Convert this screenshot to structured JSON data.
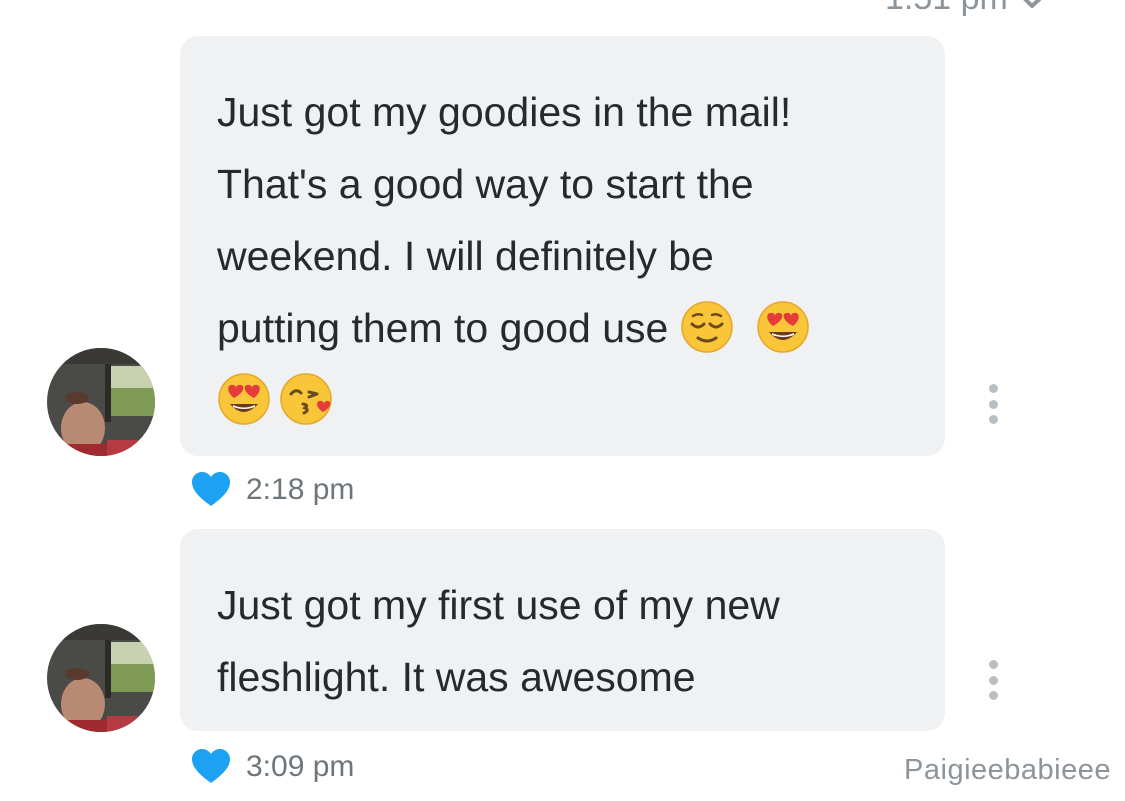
{
  "previous_message": {
    "time": "1:51 pm",
    "read_icon": "double-check-icon"
  },
  "messages": [
    {
      "text": "Just got my goodies in the mail!\nThat's a good way to start the\nweekend. I will definitely be\nputting them to good use",
      "emojis_inline": [
        "relieved-face-emoji",
        "heart-eyes-emoji"
      ],
      "emojis_next_line": [
        "heart-eyes-emoji",
        "kissing-heart-emoji"
      ],
      "time": "2:18 pm",
      "liked": true,
      "like_icon": "heart-icon",
      "menu_icon": "more-vertical-icon"
    },
    {
      "text": "Just got my first use of my new\nfleshlight. It was awesome",
      "time": "3:09 pm",
      "liked": true,
      "like_icon": "heart-icon",
      "menu_icon": "more-vertical-icon"
    }
  ],
  "watermark": "Paigieebabieee",
  "colors": {
    "bubble": "#eff1f2",
    "text": "#262a2e",
    "like": "#1da1f2",
    "meta_text": "#6f767b"
  }
}
